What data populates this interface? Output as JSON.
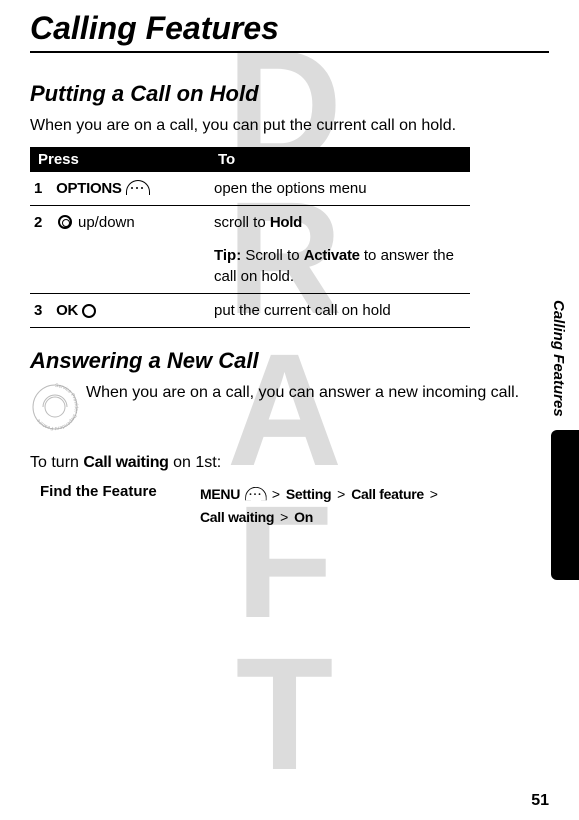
{
  "page": {
    "title": "Calling Features",
    "side_label": "Calling Features",
    "page_number": "51",
    "watermark": "DRAFT"
  },
  "section1": {
    "title": "Putting a Call on Hold",
    "intro": "When you are on a call, you can put the current call on hold.",
    "table": {
      "header_press": "Press",
      "header_to": "To",
      "rows": [
        {
          "num": "1",
          "press_label": "OPTIONS",
          "to": "open the options menu"
        },
        {
          "num": "2",
          "press_label": "up/down",
          "to_line1": "scroll to ",
          "to_bold1": "Hold",
          "tip_label": "Tip:",
          "tip_text_a": " Scroll to ",
          "tip_bold": "Activate",
          "tip_text_b": " to answer the call on hold."
        },
        {
          "num": "3",
          "press_label": "OK",
          "to": "put the current call on hold"
        }
      ]
    }
  },
  "section2": {
    "title": "Answering a New Call",
    "intro": "When you are on a call, you can answer a new incoming call.",
    "turn_on": {
      "prefix": "To turn ",
      "bold": "Call waiting",
      "suffix": " on 1st:"
    },
    "find_feature": {
      "label": "Find the Feature",
      "menu": "MENU",
      "gt": ">",
      "path1": "Setting",
      "path2": "Call feature",
      "path3": "Call waiting",
      "path4": "On"
    }
  }
}
